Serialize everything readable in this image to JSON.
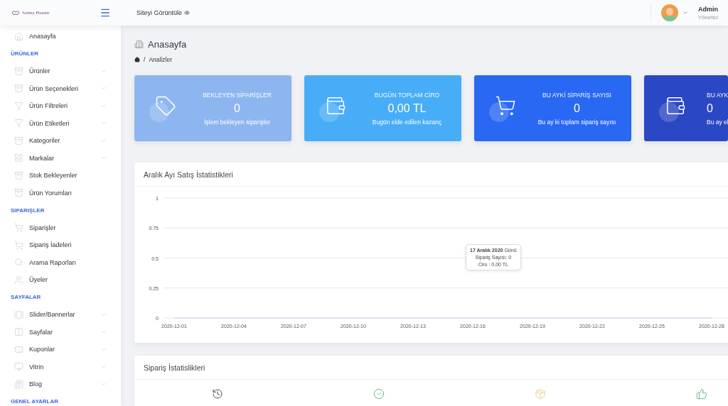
{
  "topbar": {
    "logo": "Selma Hanım",
    "view_site": "Siteyi Görüntüle",
    "user": {
      "name": "Admin",
      "role": "Yönetici"
    }
  },
  "sidebar": {
    "items": [
      {
        "kind": "item",
        "label": "Anasayfa",
        "expandable": false
      },
      {
        "kind": "heading",
        "label": "ÜRÜNLER"
      },
      {
        "kind": "item",
        "label": "Ürünler",
        "expandable": true
      },
      {
        "kind": "item",
        "label": "Ürün Seçenekleri",
        "expandable": true
      },
      {
        "kind": "item",
        "label": "Ürün Filtreleri",
        "expandable": true
      },
      {
        "kind": "item",
        "label": "Ürün Etiketleri",
        "expandable": true
      },
      {
        "kind": "item",
        "label": "Kategoriler",
        "expandable": true
      },
      {
        "kind": "item",
        "label": "Markalar",
        "expandable": true
      },
      {
        "kind": "item",
        "label": "Stok Bekleyenler",
        "expandable": false
      },
      {
        "kind": "item",
        "label": "Ürün Yorumları",
        "expandable": false
      },
      {
        "kind": "heading",
        "label": "SIPARIŞLER"
      },
      {
        "kind": "item",
        "label": "Siparişler",
        "expandable": false
      },
      {
        "kind": "item",
        "label": "Sipariş İadeleri",
        "expandable": false
      },
      {
        "kind": "item",
        "label": "Arama Raporları",
        "expandable": false
      },
      {
        "kind": "item",
        "label": "Üyeler",
        "expandable": false
      },
      {
        "kind": "heading",
        "label": "SAYFALAR"
      },
      {
        "kind": "item",
        "label": "Slider/Bannerlar",
        "expandable": true
      },
      {
        "kind": "item",
        "label": "Sayfalar",
        "expandable": true
      },
      {
        "kind": "item",
        "label": "Kuponlar",
        "expandable": true
      },
      {
        "kind": "item",
        "label": "Vitrin",
        "expandable": true
      },
      {
        "kind": "item",
        "label": "Blog",
        "expandable": true
      },
      {
        "kind": "heading",
        "label": "GENEL AYARLAR"
      }
    ]
  },
  "page": {
    "title": "Anasayfa",
    "breadcrumb_separator": "/",
    "breadcrumb": "Analizler"
  },
  "stat_cards": [
    {
      "title": "BEKLEYEN SİPARİŞLER",
      "value": "0",
      "subtitle": "İşlem bekleyen siparişler",
      "color": "#8db6f0"
    },
    {
      "title": "BUGÜN TOPLAM CİRO",
      "value": "0,00 TL",
      "subtitle": "Bugün elde edilen kazanç",
      "color": "#48adf7"
    },
    {
      "title": "BU AYKİ SİPARİŞ SAYISI",
      "value": "0",
      "subtitle": "Bu ay ki toplam sipariş sayısı",
      "color": "#2868f3"
    },
    {
      "title": "BU AYK",
      "value": "0",
      "subtitle": "Bu ay el",
      "color": "#2a47c4"
    }
  ],
  "sales_chart": {
    "title": "Aralık Ayı Satış İstatistikleri",
    "chart_data": {
      "type": "line",
      "categories": [
        "2020-12-01",
        "2020-12-04",
        "2020-12-07",
        "2020-12-10",
        "2020-12-13",
        "2020-12-16",
        "2020-12-19",
        "2020-12-22",
        "2020-12-25",
        "2020-12-28"
      ],
      "series": [
        {
          "color": "#c9d3e6",
          "values": [
            0,
            0,
            0,
            0,
            0,
            0,
            0,
            0,
            0,
            0
          ]
        }
      ],
      "ylim": [
        0,
        1
      ],
      "yticks": [
        0,
        0.25,
        0.5,
        0.75,
        1
      ],
      "grid": true
    },
    "tooltip": {
      "heading": "**17 Aralık 2020** Günü",
      "lines": [
        "Sipariş Sayısı: 0",
        "Ciro : 0,00 TL"
      ]
    }
  },
  "order_stats": {
    "title": "Sipariş İstatislikleri"
  }
}
